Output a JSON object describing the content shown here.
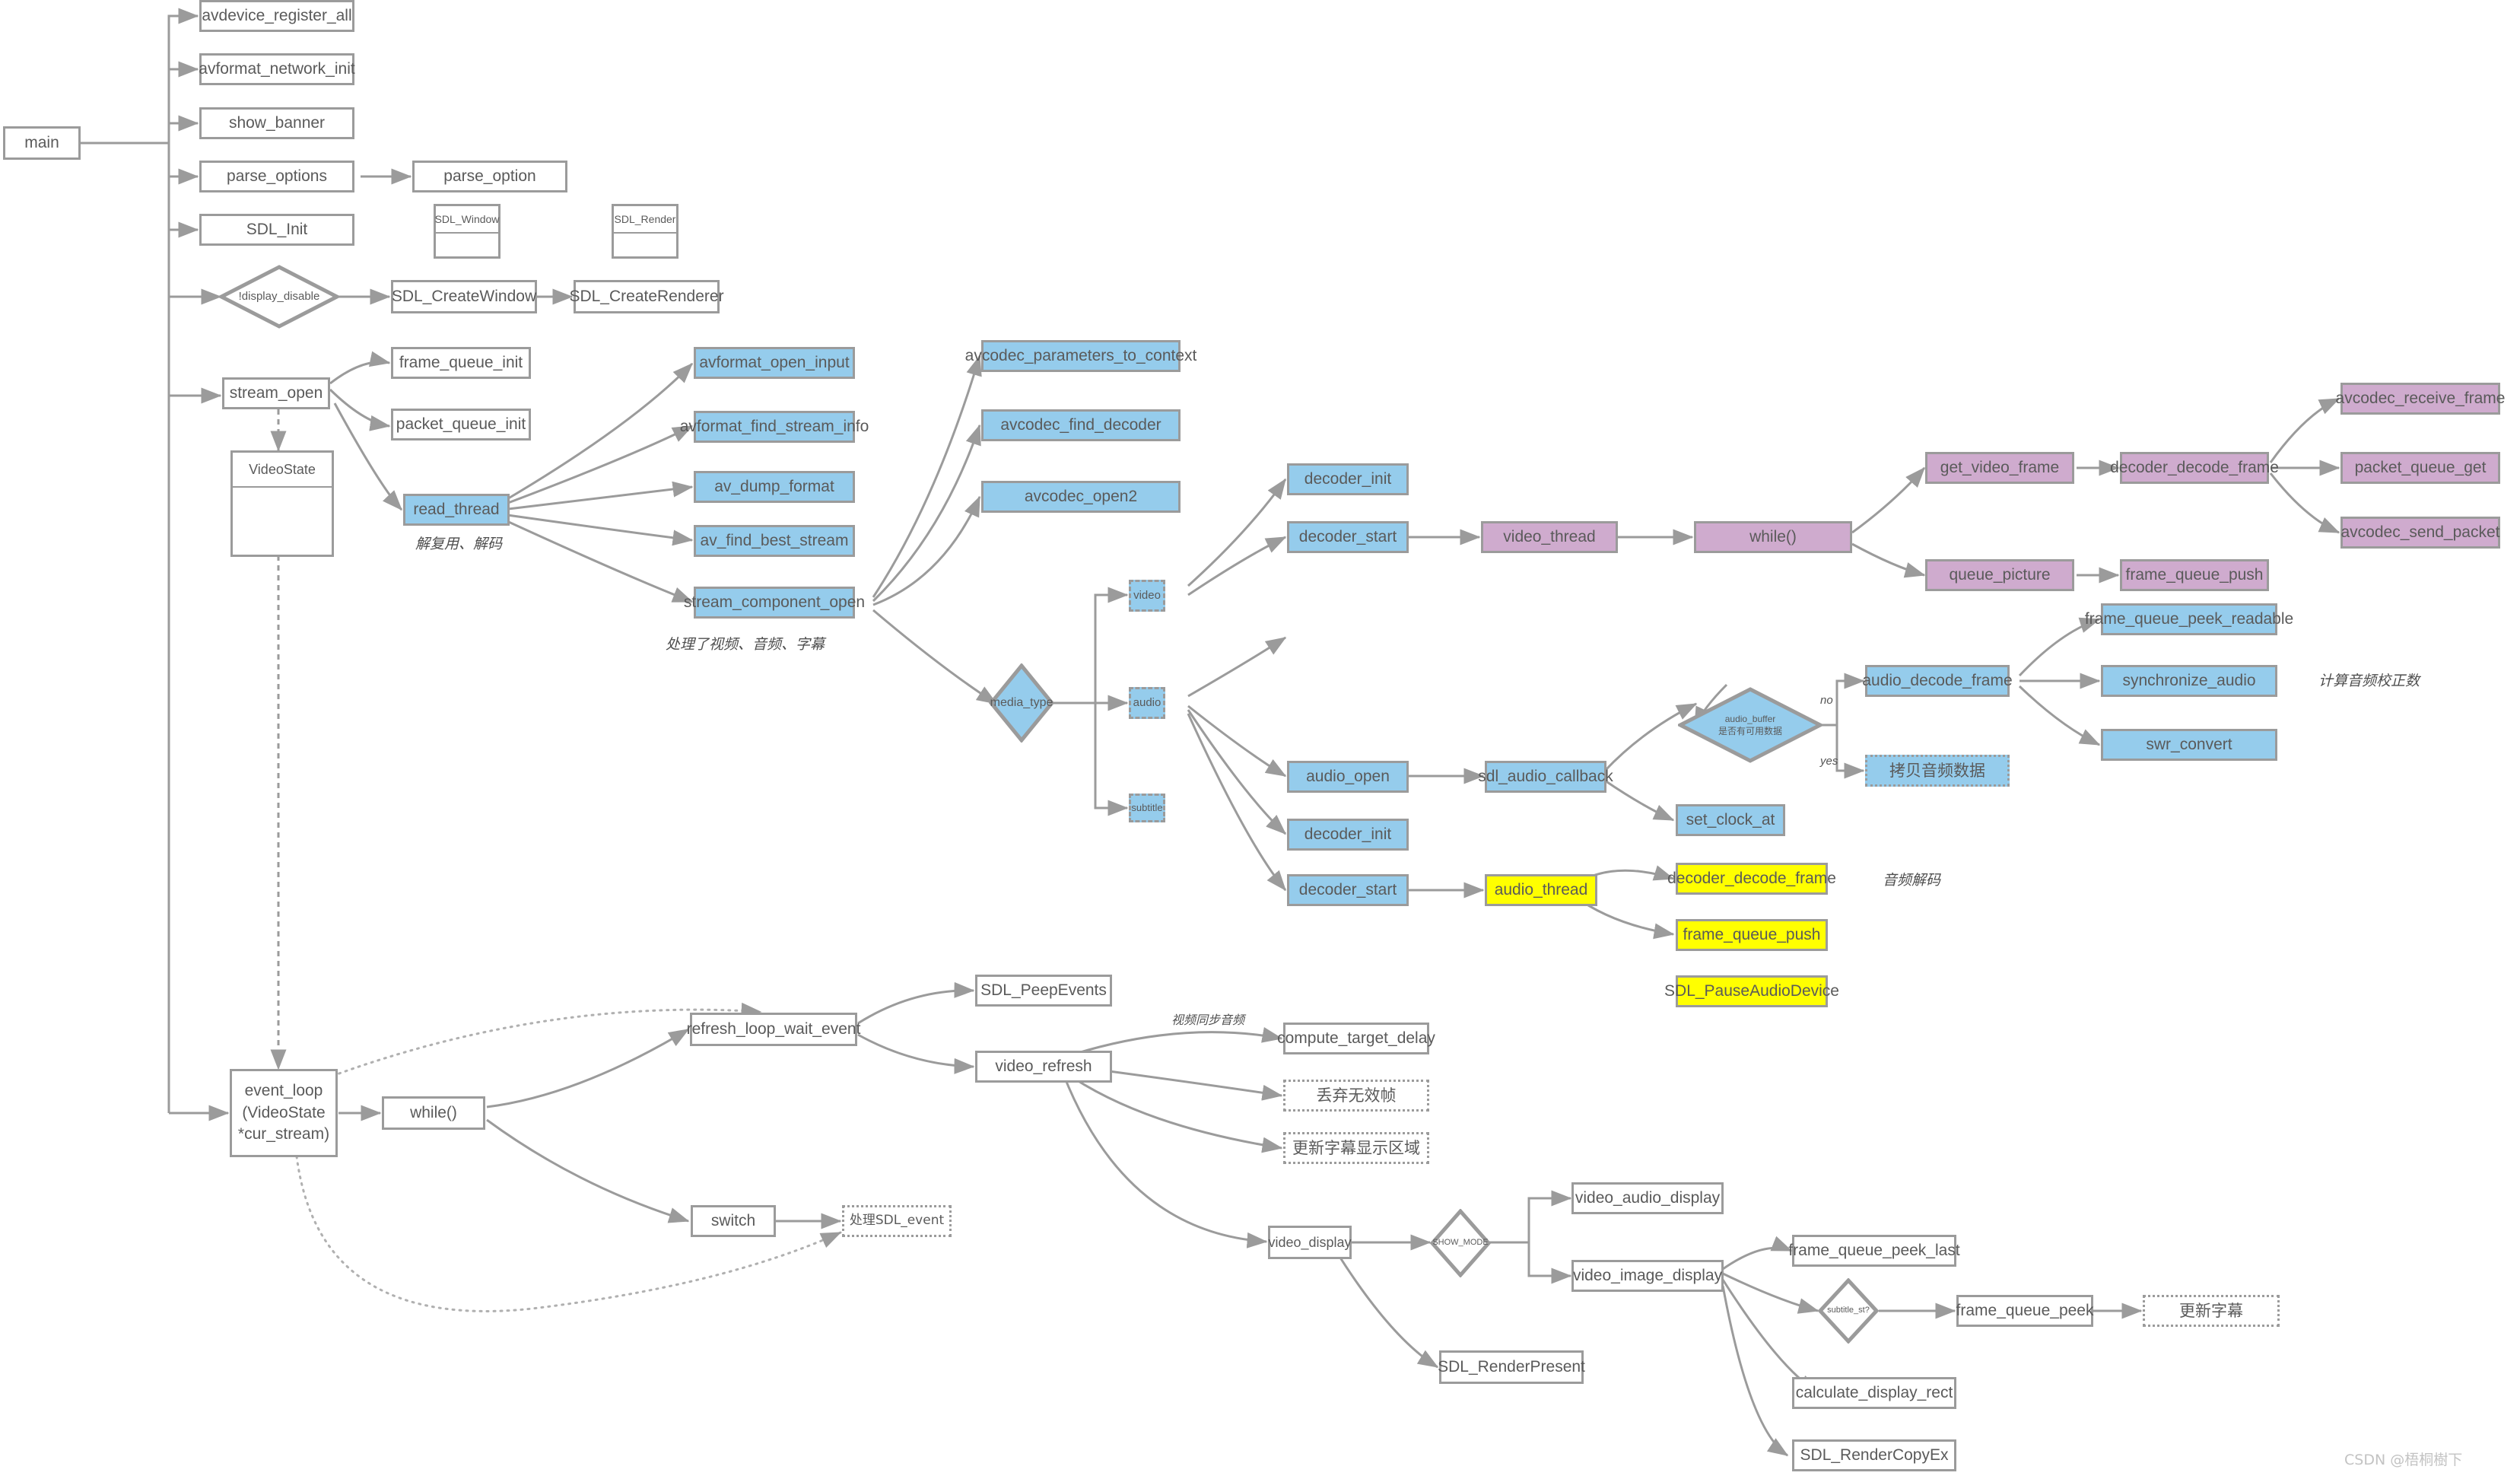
{
  "diagram": {
    "title": "ffplay call flow",
    "colors": {
      "blue": "#95ccec",
      "purple": "#cfabce",
      "yellow": "#ffff00",
      "border": "#9b9b9b",
      "text": "#5a5a5a",
      "watermark": "#c3c3c3"
    }
  },
  "nodes": {
    "main": "main",
    "avdevice_register_all": "avdevice_register_all",
    "avformat_network_init": "avformat_network_init",
    "show_banner": "show_banner",
    "parse_options": "parse_options",
    "parse_option": "parse_option",
    "sdl_init": "SDL_Init",
    "display_disable": "!display_disable",
    "sdl_createwindow": "SDL_CreateWindow",
    "sdl_createrenderer": "SDL_CreateRenderer",
    "sdl_window_class": "SDL_Window",
    "sdl_render_class": "SDL_Render",
    "stream_open": "stream_open",
    "frame_queue_init": "frame_queue_init",
    "packet_queue_init": "packet_queue_init",
    "videostate_class": "VideoState",
    "read_thread": "read_thread",
    "avformat_open_input": "avformat_open_input",
    "avformat_find_stream_info": "avformat_find_stream_info",
    "av_dump_format": "av_dump_format",
    "av_find_best_stream": "av_find_best_stream",
    "stream_component_open": "stream_component_open",
    "avcodec_parameters_to_context": "avcodec_parameters_to_context",
    "avcodec_find_decoder": "avcodec_find_decoder",
    "avcodec_open2": "avcodec_open2",
    "media_type": "media_type",
    "video": "video",
    "audio": "audio",
    "subtitle": "subtitle",
    "decoder_init_v": "decoder_init",
    "decoder_start_v": "decoder_start",
    "video_thread": "video_thread",
    "while_video": "while()",
    "get_video_frame": "get_video_frame",
    "decoder_decode_frame_v": "decoder_decode_frame",
    "avcodec_receive_frame": "avcodec_receive_frame",
    "packet_queue_get": "packet_queue_get",
    "avcodec_send_packet": "avcodec_send_packet",
    "queue_picture": "queue_picture",
    "frame_queue_push_v": "frame_queue_push",
    "audio_open": "audio_open",
    "sdl_audio_callback": "sdl_audio_callback",
    "set_clock_at": "set_clock_at",
    "decoder_init_a": "decoder_init",
    "decoder_start_a": "decoder_start",
    "audio_thread": "audio_thread",
    "decoder_decode_frame_a": "decoder_decode_frame",
    "frame_queue_push_a": "frame_queue_push",
    "sdl_pauseaudiodevice": "SDL_PauseAudioDevice",
    "audio_buffer_line1": "audio_buffer",
    "audio_buffer_line2": "是否有可用数据",
    "audio_decode_frame": "audio_decode_frame",
    "copy_audio_data": "拷贝音频数据",
    "frame_queue_peek_readable": "frame_queue_peek_readable",
    "synchronize_audio": "synchronize_audio",
    "swr_convert": "swr_convert",
    "event_loop_l1": "event_loop",
    "event_loop_l2": "(VideoState",
    "event_loop_l3": "*cur_stream)",
    "while_event": "while()",
    "refresh_loop_wait_event": "refresh_loop_wait_event",
    "sdl_peepevents": "SDL_PeepEvents",
    "video_refresh": "video_refresh",
    "compute_target_delay": "compute_target_delay",
    "drop_invalid_frame": "丢弃无效帧",
    "update_subtitle_area": "更新字幕显示区域",
    "switch": "switch",
    "handle_sdl_event": "处理SDL_event",
    "video_display": "video_display",
    "show_mode": "SHOW_MODE",
    "video_audio_display": "video_audio_display",
    "video_image_display": "video_image_display",
    "frame_queue_peek_last": "frame_queue_peek_last",
    "subtitle_st": "subtitle_st?",
    "frame_queue_peek": "frame_queue_peek",
    "update_subtitle": "更新字幕",
    "calculate_display_rect": "calculate_display_rect",
    "sdl_rendercopyex": "SDL_RenderCopyEx",
    "sdl_renderpresent": "SDL_RenderPresent"
  },
  "notes": {
    "read_thread_note": "解复用、解码",
    "stream_component_open_note": "处理了视频、音频、字幕",
    "audio_calc_note": "计算音频校正数",
    "audio_decode_note": "音频解码",
    "video_sync_audio_note": "视频同步音频"
  },
  "edge_labels": {
    "audio_buffer_no": "no",
    "audio_buffer_yes": "yes"
  },
  "watermark": "CSDN @梧桐樹下"
}
